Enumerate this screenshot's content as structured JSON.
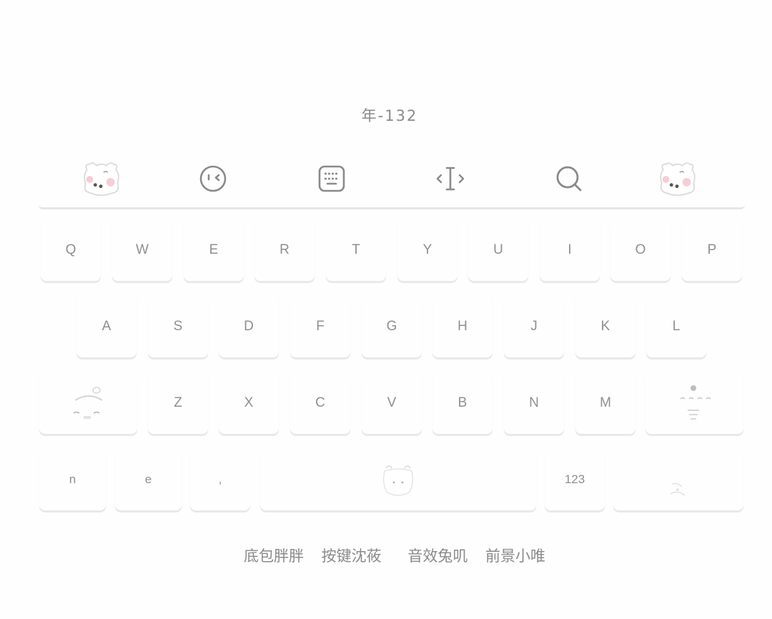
{
  "title": "年-132",
  "toolbar": {
    "items": [
      {
        "name": "bear-logo-left-icon"
      },
      {
        "name": "emoji-wink-icon"
      },
      {
        "name": "keyboard-icon"
      },
      {
        "name": "cursor-move-icon"
      },
      {
        "name": "search-icon"
      },
      {
        "name": "bear-logo-right-icon"
      }
    ]
  },
  "keyboard": {
    "row1": [
      "Q",
      "W",
      "E",
      "R",
      "T",
      "Y",
      "U",
      "I",
      "O",
      "P"
    ],
    "row2": [
      "A",
      "S",
      "D",
      "F",
      "G",
      "H",
      "J",
      "K",
      "L"
    ],
    "row3": {
      "shift_icon": "bunny-shift-icon",
      "letters": [
        "Z",
        "X",
        "C",
        "V",
        "B",
        "N",
        "M"
      ],
      "backspace_icon": "bunny-backspace-icon"
    },
    "row4": {
      "key1": "n",
      "key2": "e",
      "key3": ",",
      "space_icon": "bunny-space-icon",
      "numbers": "123",
      "enter_icon": "bunny-enter-icon"
    }
  },
  "footer": {
    "credit1": "底包胖胖",
    "credit2": "按键沈莜",
    "credit3": "音效兔叽",
    "credit4": "前景小唯"
  },
  "colors": {
    "background": "#fefefe",
    "text": "#8f8f8f",
    "key_shadow": "#e9e9e9",
    "accent_pink": "#f4c6cf"
  }
}
